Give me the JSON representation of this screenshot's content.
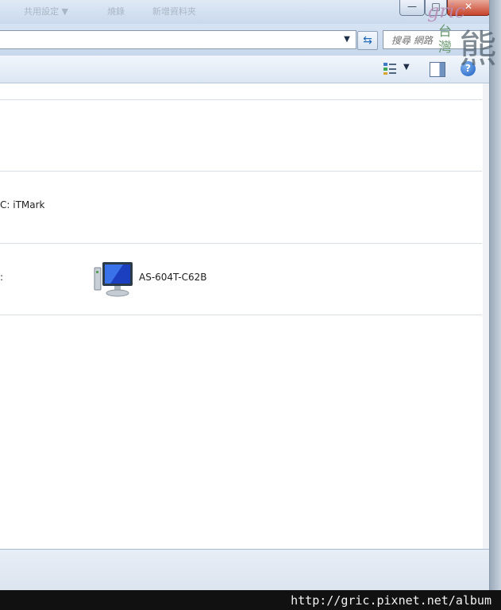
{
  "window": {
    "faint_menu": [
      "共用設定 ▼",
      "燒錄",
      "新增資料夾"
    ],
    "controls": {
      "minimize": "—",
      "maximize": "□",
      "close": "✕"
    }
  },
  "address_bar": {
    "value": "",
    "dropdown_icon": "chevron-down-icon",
    "refresh_icon": "refresh-icon",
    "search_placeholder": "搜尋 網路"
  },
  "command_bar": {
    "view_icon": "view-options-icon",
    "pane_icon": "preview-pane-icon",
    "help_label": "?"
  },
  "content": {
    "groups": [
      {
        "label": ""
      },
      {
        "label": "C: iTMark"
      },
      {
        "label": ":"
      }
    ],
    "device": {
      "name": "AS-604T-C62B",
      "icon": "computer-icon"
    }
  },
  "watermark": {
    "text": "gric",
    "sub": "台灣",
    "big": "熊"
  },
  "footer": {
    "url": "http://gric.pixnet.net/album"
  }
}
